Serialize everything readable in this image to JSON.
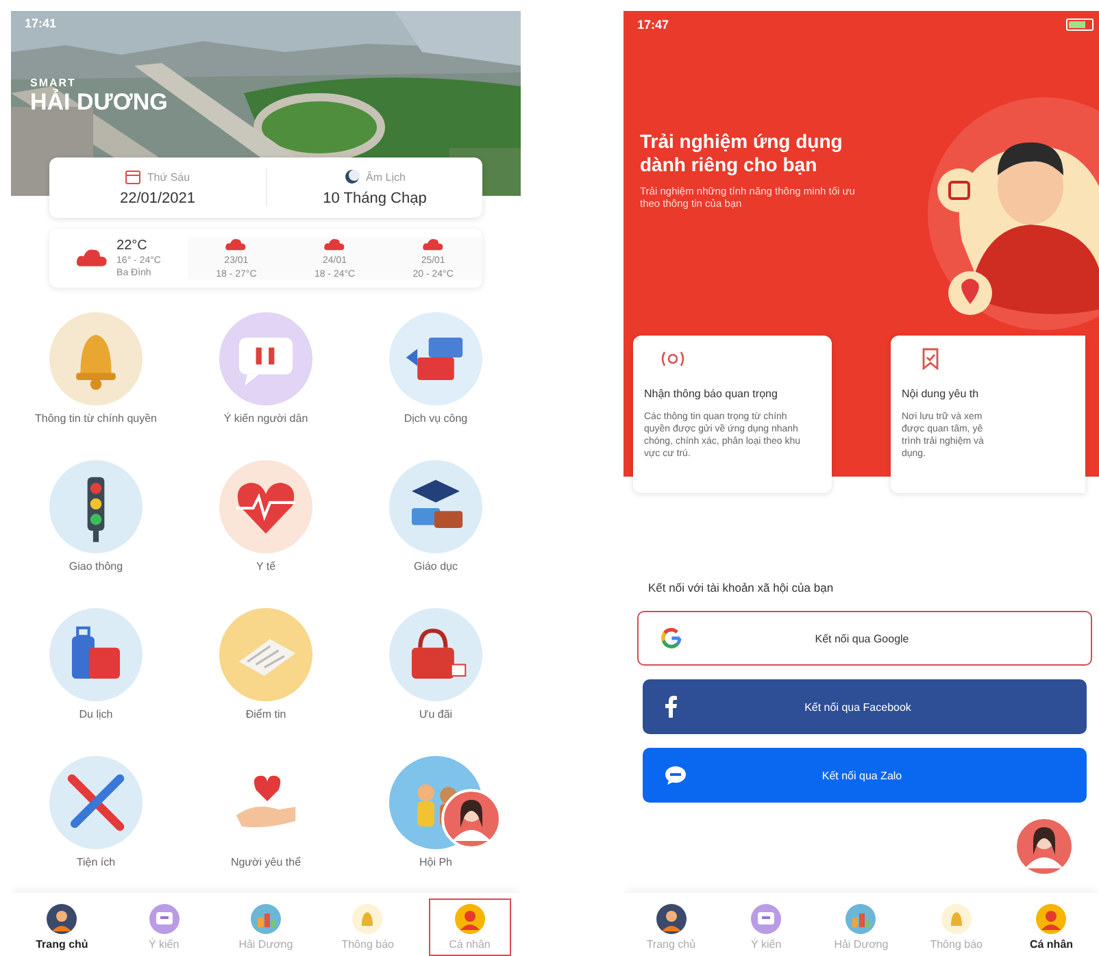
{
  "home": {
    "status_time": "17:41",
    "brand_small": "SMART",
    "brand": "HẢI DƯƠNG",
    "date_card": [
      {
        "label": "Thứ Sáu",
        "value": "22/01/2021"
      },
      {
        "label": "Âm Lịch",
        "value": "10 Tháng Chạp"
      }
    ],
    "weather": {
      "today": {
        "temp": "22°C",
        "range": "16° - 24°C",
        "place": "Ba Đình"
      },
      "forecast": [
        {
          "date": "23/01",
          "range": "18 - 27°C"
        },
        {
          "date": "24/01",
          "range": "18 - 24°C"
        },
        {
          "date": "25/01",
          "range": "20 - 24°C"
        }
      ]
    },
    "services": [
      {
        "label": "Thông tin từ chính quyền"
      },
      {
        "label": "Ý kiến người dân"
      },
      {
        "label": "Dịch vụ công"
      },
      {
        "label": "Giao thông"
      },
      {
        "label": "Y tế"
      },
      {
        "label": "Giáo dục"
      },
      {
        "label": "Du lịch"
      },
      {
        "label": "Điểm tin"
      },
      {
        "label": "Ưu đãi"
      },
      {
        "label": "Tiện ích"
      },
      {
        "label": "Người yêu thể"
      },
      {
        "label": "Hội Ph"
      }
    ],
    "tabs": [
      {
        "label": "Trang chủ",
        "selected": true,
        "highlighted": false
      },
      {
        "label": "Ý kiến",
        "selected": false,
        "highlighted": false
      },
      {
        "label": "Hải Dương",
        "selected": false,
        "highlighted": false
      },
      {
        "label": "Thông báo",
        "selected": false,
        "highlighted": false
      },
      {
        "label": "Cá nhân",
        "selected": false,
        "highlighted": true
      }
    ]
  },
  "profile": {
    "status_time": "17:47",
    "title": "Trải nghiệm ứng dụng dành riêng cho bạn",
    "subtitle": "Trải nghiệm những tính năng thông minh tối ưu theo thông tin của bạn",
    "features": [
      {
        "title": "Nhận thông báo quan trọng",
        "lines": [
          "Các thông tin quan trọng từ chính",
          "quyền được gửi về ứng dụng nhanh",
          "chóng, chính xác, phân loại theo khu",
          "vực cư trú."
        ]
      },
      {
        "title": "Nội dung yêu th",
        "lines": [
          "Nơi lưu trữ và xem",
          "được quan tâm, yê",
          "trình trải nghiệm và",
          "dụng."
        ]
      }
    ],
    "connect_heading": "Kết nối với tài khoản xã hội của bạn",
    "connect_buttons": [
      {
        "kind": "google",
        "label": "Kết nối qua Google",
        "highlighted": true
      },
      {
        "kind": "facebook",
        "label": "Kết nối qua Facebook",
        "highlighted": false
      },
      {
        "kind": "zalo",
        "label": "Kết nối qua Zalo",
        "highlighted": false
      }
    ],
    "tabs": [
      {
        "label": "Trang chủ",
        "selected": false,
        "highlighted": false
      },
      {
        "label": "Ý kiến",
        "selected": false,
        "highlighted": false
      },
      {
        "label": "Hải Dương",
        "selected": false,
        "highlighted": false
      },
      {
        "label": "Thông báo",
        "selected": false,
        "highlighted": false
      },
      {
        "label": "Cá nhân",
        "selected": true,
        "highlighted": false
      }
    ]
  }
}
